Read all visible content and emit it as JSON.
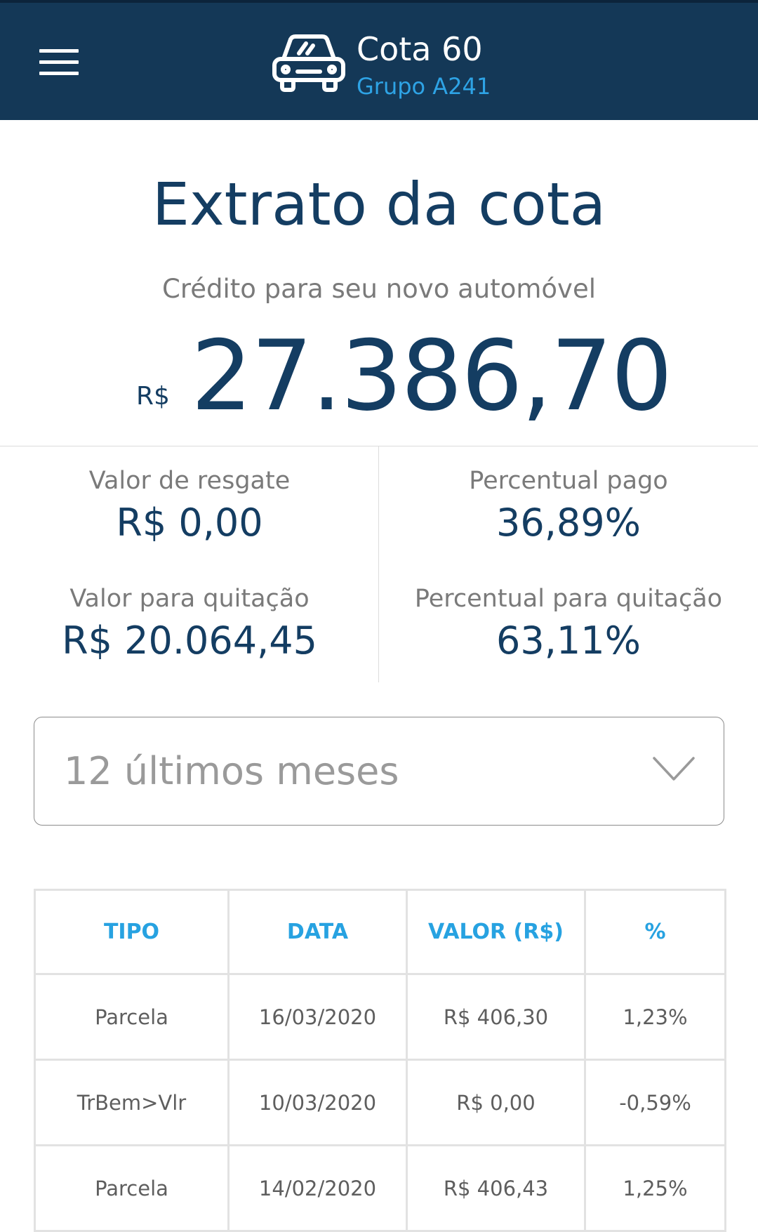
{
  "header": {
    "title": "Cota 60",
    "subtitle": "Grupo A241",
    "icon": "car-icon",
    "menu_icon": "hamburger-menu-icon"
  },
  "page": {
    "title": "Extrato da cota",
    "credit_label": "Crédito para seu novo automóvel",
    "credit_currency": "R$",
    "credit_value": "27.386,70"
  },
  "stats": {
    "valor_resgate": {
      "label": "Valor de resgate",
      "value": "R$  0,00"
    },
    "percentual_pago": {
      "label": "Percentual pago",
      "value": "36,89%"
    },
    "valor_quitacao": {
      "label": "Valor para quitação",
      "value": "R$  20.064,45"
    },
    "percentual_quitacao": {
      "label": "Percentual para quitação",
      "value": "63,11%"
    }
  },
  "period_select": {
    "value": "12 últimos meses",
    "icon": "chevron-down-icon"
  },
  "table": {
    "headers": [
      "TIPO",
      "DATA",
      "VALOR (R$)",
      "%"
    ],
    "rows": [
      [
        "Parcela",
        "16/03/2020",
        "R$  406,30",
        "1,23%"
      ],
      [
        "TrBem>Vlr",
        "10/03/2020",
        "R$  0,00",
        "-0,59%"
      ],
      [
        "Parcela",
        "14/02/2020",
        "R$  406,43",
        "1,25%"
      ]
    ]
  },
  "colors": {
    "header_bg": "#143857",
    "accent_blue": "#2ea3e5",
    "primary_text": "#143d62",
    "muted_text": "#7a7a7a"
  }
}
